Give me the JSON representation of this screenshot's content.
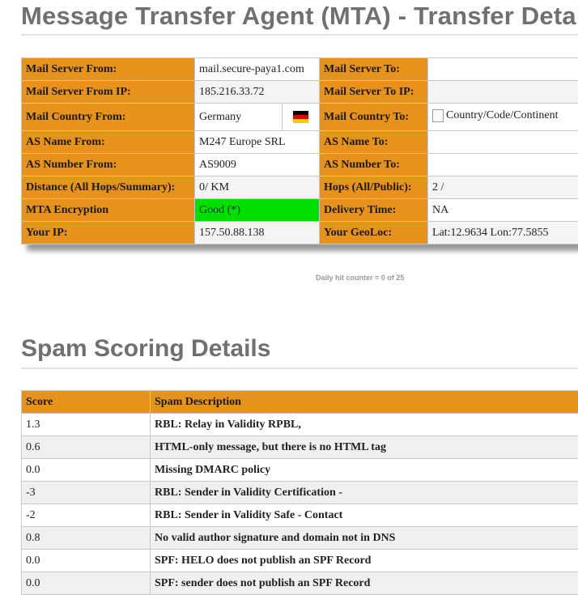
{
  "mta": {
    "title": "Message Transfer Agent (MTA) - Transfer Details",
    "rows": {
      "server_from_label": "Mail Server From:",
      "server_from_value": "mail.secure-paya1.com",
      "server_to_label": "Mail Server To:",
      "server_to_value": "",
      "server_from_ip_label": "Mail Server From IP:",
      "server_from_ip_value": "185.216.33.72",
      "server_to_ip_label": "Mail Server To IP:",
      "server_to_ip_value": "",
      "country_from_label": "Mail Country From:",
      "country_from_value": "Germany",
      "country_from_flag": "germany-flag",
      "country_to_label": "Mail Country To:",
      "country_to_value": "Country/Code/Continent",
      "as_name_from_label": "AS Name From:",
      "as_name_from_value": "M247 Europe SRL",
      "as_name_to_label": "AS Name To:",
      "as_name_to_value": "",
      "as_number_from_label": "AS Number From:",
      "as_number_from_value": "AS9009",
      "as_number_to_label": "AS Number To:",
      "as_number_to_value": "",
      "distance_label": "Distance (All Hops/Summary):",
      "distance_value": "0/ KM",
      "hops_label": "Hops (All/Public):",
      "hops_value": "2 /",
      "encryption_label": "MTA Encryption",
      "encryption_value": "Good (*)",
      "delivery_time_label": "Delivery Time:",
      "delivery_time_value": "NA",
      "your_ip_label": "Your IP:",
      "your_ip_value": "157.50.88.138",
      "geoloc_label": "Your GeoLoc:",
      "geoloc_value": "Lat:12.9634 Lon:77.5855"
    }
  },
  "counter": "Daily hit counter = 0 of 25",
  "spam": {
    "title": "Spam Scoring Details",
    "header_score": "Score",
    "header_desc": "Spam Description",
    "rows": [
      {
        "score": "1.3",
        "desc": "RBL: Relay in Validity RPBL,"
      },
      {
        "score": "0.6",
        "desc": "HTML-only message, but there is no HTML tag"
      },
      {
        "score": "0.0",
        "desc": "Missing DMARC policy"
      },
      {
        "score": "-3",
        "desc": "RBL: Sender in Validity Certification -"
      },
      {
        "score": "-2",
        "desc": "RBL: Sender in Validity Safe - Contact"
      },
      {
        "score": "0.8",
        "desc": "No valid author signature and domain not in DNS"
      },
      {
        "score": "0.0",
        "desc": "SPF: HELO does not publish an SPF Record"
      },
      {
        "score": "0.0",
        "desc": "SPF: sender does not publish an SPF Record"
      }
    ]
  },
  "colors": {
    "label_bg": "#e8921e",
    "good_bg": "#00e000",
    "heading": "#707070"
  }
}
